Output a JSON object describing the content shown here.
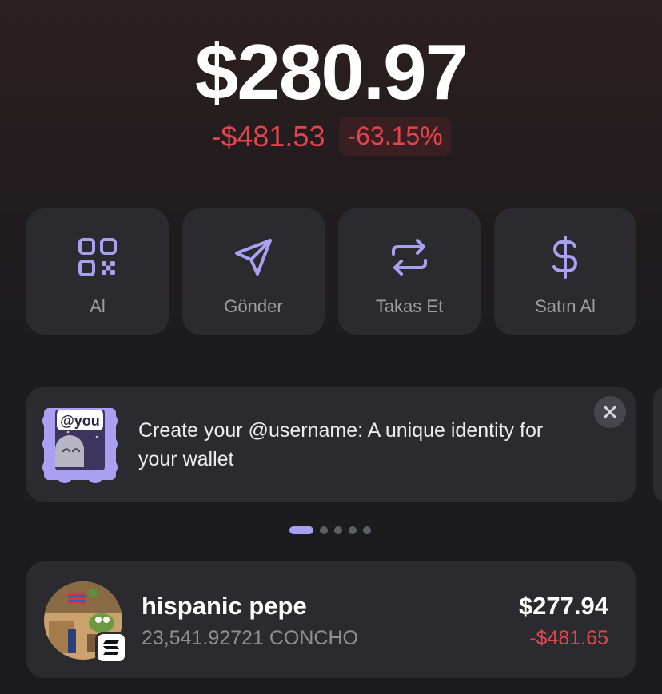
{
  "balance": {
    "total": "$280.97",
    "change_amount": "-$481.53",
    "change_percent": "-63.15%"
  },
  "actions": [
    {
      "label": "Al",
      "icon": "qr-code-icon"
    },
    {
      "label": "Gönder",
      "icon": "send-icon"
    },
    {
      "label": "Takas Et",
      "icon": "swap-icon"
    },
    {
      "label": "Satın Al",
      "icon": "dollar-icon"
    }
  ],
  "banner": {
    "badge_text": "@you",
    "message": "Create your @username: A unique identity for your wallet",
    "close_icon": "close-icon"
  },
  "pager": {
    "count": 5,
    "active_index": 0
  },
  "tokens": [
    {
      "name": "hispanic pepe",
      "quantity": "23,541.92721 CONCHO",
      "value": "$277.94",
      "change": "-$481.65",
      "chain_icon": "solana-icon"
    }
  ],
  "colors": {
    "accent": "#ab9ff2",
    "negative": "#e5444d",
    "card": "#2b2b2f",
    "background": "#1c1c1e"
  }
}
